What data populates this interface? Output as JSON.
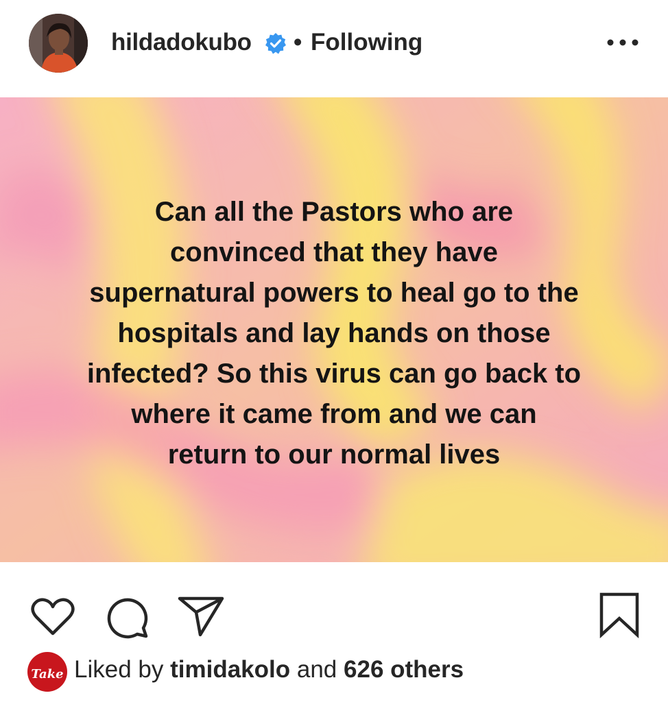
{
  "header": {
    "username": "hildadokubo",
    "separator": "•",
    "follow_status": "Following",
    "verified": true,
    "more_icon": "ellipsis-icon"
  },
  "post": {
    "image_text": "Can all the Pastors who are\nconvinced that they have\nsupernatural powers to heal go to the\nhospitals and lay hands on those\ninfected? So this virus can go back to\nwhere it came from and we can\nreturn to our normal lives",
    "background_colors": [
      "#f6a9c0",
      "#f9e36a",
      "#f5b98f"
    ]
  },
  "actions": {
    "icons": [
      "heart-icon",
      "comment-icon",
      "share-icon",
      "bookmark-icon"
    ]
  },
  "likes": {
    "prefix": "Liked by",
    "liker": "timidakolo",
    "connector": "and",
    "count_text": "626 others",
    "liker_avatar_text": "Take"
  },
  "colors": {
    "verified_badge": "#3897f0",
    "text": "#262626"
  }
}
